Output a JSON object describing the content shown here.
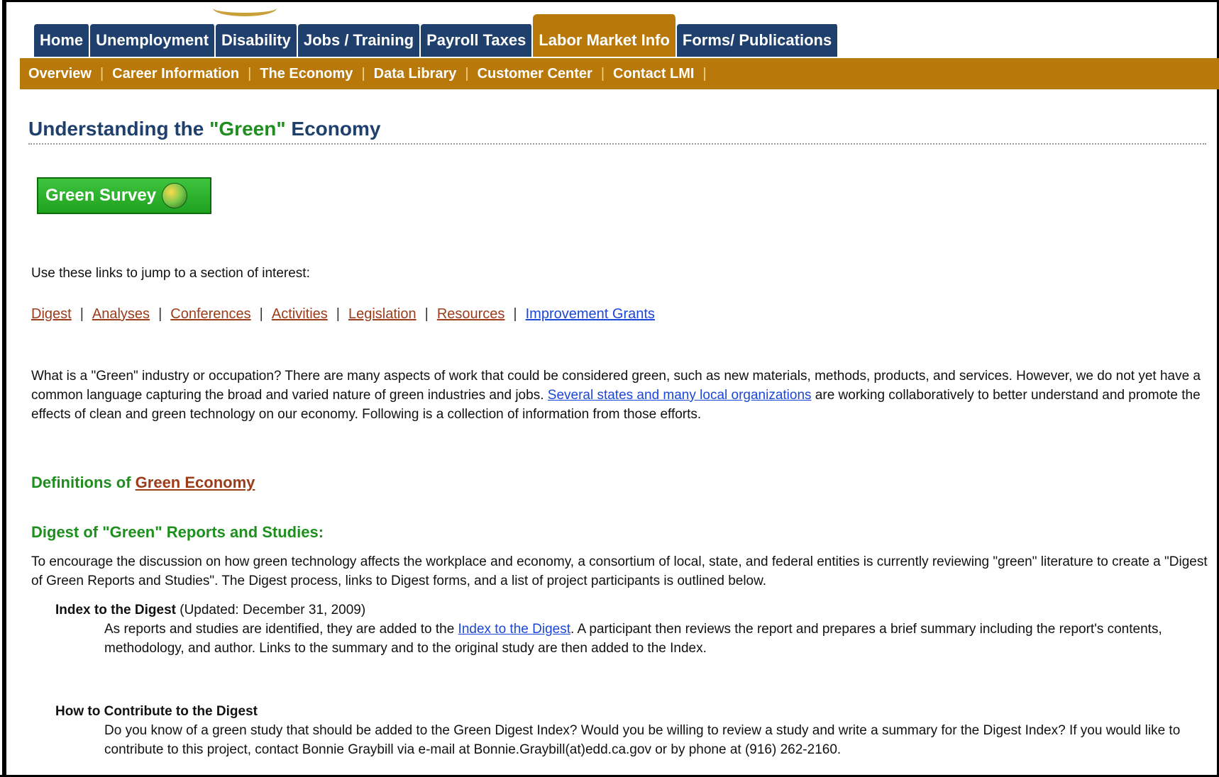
{
  "tabs": [
    {
      "label": "Home"
    },
    {
      "label": "Unemployment"
    },
    {
      "label": "Disability"
    },
    {
      "label": "Jobs / Training"
    },
    {
      "label": "Payroll Taxes"
    },
    {
      "label": "Labor Market Info"
    },
    {
      "label": "Forms/ Publications"
    }
  ],
  "subnav": [
    "Overview",
    "Career Information",
    "The Economy",
    "Data Library",
    "Customer Center",
    "Contact LMI"
  ],
  "title": {
    "pre": "Understanding the ",
    "green": "\"Green\"",
    "post": " Economy"
  },
  "green_button": {
    "label": "Green Survey"
  },
  "intro": "Use these links to jump to a section of interest:",
  "jump_links": [
    "Digest",
    "Analyses",
    "Conferences",
    "Activities",
    "Legislation",
    "Resources"
  ],
  "jump_link_blue": "Improvement Grants",
  "para1": {
    "a": "What is a \"Green\" industry or occupation? There are many aspects of work that could be considered green, such as new materials, methods, products, and services. However, we do not yet have a common language capturing the broad and varied nature of green industries and jobs. ",
    "link": "Several states and many local organizations",
    "b": " are working collaboratively to better understand and promote the effects of clean and green technology on our economy. Following is a collection of information from those efforts."
  },
  "definitions": {
    "pre": "Definitions of ",
    "link": "Green Economy"
  },
  "digest_heading": "Digest of \"Green\" Reports and Studies:",
  "para2": "To encourage the discussion on how green technology affects the workplace and economy, a consortium of local, state, and federal entities is currently reviewing \"green\" literature to create a \"Digest of Green Reports and Studies\". The Digest process, links to Digest forms, and a list of project participants is outlined below.",
  "index": {
    "heading": "Index to the Digest",
    "note": "(Updated: December 31, 2009)",
    "body_a": "As reports and studies are identified, they are added to the ",
    "body_link": "Index to the Digest",
    "body_b": ". A participant then reviews the report and prepares a brief summary including the report's contents, methodology, and author. Links to the summary and to the original study are then added to the Index."
  },
  "contribute": {
    "heading": "How to Contribute to the Digest",
    "body": "Do you know of a green study that should be added to the Green Digest Index? Would you be willing to review a study and write a summary for the Digest Index? If you would like to contribute to this project, contact Bonnie Graybill via e-mail at Bonnie.Graybill(at)edd.ca.gov or by phone at (916) 262-2160."
  }
}
